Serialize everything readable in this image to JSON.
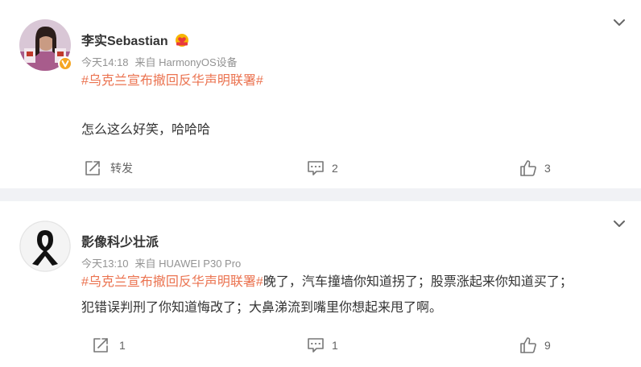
{
  "posts": [
    {
      "author": "李实Sebastian",
      "time": "今天14:18",
      "source": "来自 HarmonyOS设备",
      "topic": "#乌克兰宣布撤回反华声明联署#",
      "text_line1": "",
      "text_line2": "怎么这么好笑，哈哈哈",
      "repost_label": "转发",
      "comments": "2",
      "likes": "3"
    },
    {
      "author": "影像科少壮派",
      "time": "今天13:10",
      "source": "来自 HUAWEI P30 Pro",
      "topic": "#乌克兰宣布撤回反华声明联署#",
      "text_line1": "晚了，汽车撞墙你知道拐了；股票涨起来你知道买了；",
      "text_line2": "犯错误判刑了你知道悔改了；大鼻涕流到嘴里你想起来甩了啊。",
      "reposts": "1",
      "comments": "1",
      "likes": "9"
    }
  ],
  "colors": {
    "topic": "#eb7350",
    "meta": "#939393",
    "page_bg": "#f1f2f5",
    "verified_badge": "#f5a623"
  },
  "icons": [
    "chevron-down-icon",
    "repost-icon",
    "comment-icon",
    "like-icon",
    "verified-badge-icon",
    "vip-badge-icon",
    "mourning-ribbon-icon"
  ]
}
